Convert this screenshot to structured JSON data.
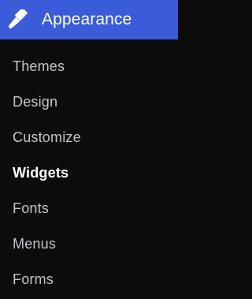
{
  "header": {
    "icon": "paintbrush-icon",
    "title": "Appearance",
    "background_color": "#3a5cd8"
  },
  "submenu": {
    "items": [
      {
        "label": "Themes",
        "current": false
      },
      {
        "label": "Design",
        "current": false
      },
      {
        "label": "Customize",
        "current": false
      },
      {
        "label": "Widgets",
        "current": true
      },
      {
        "label": "Fonts",
        "current": false
      },
      {
        "label": "Menus",
        "current": false
      },
      {
        "label": "Forms",
        "current": false
      }
    ]
  }
}
